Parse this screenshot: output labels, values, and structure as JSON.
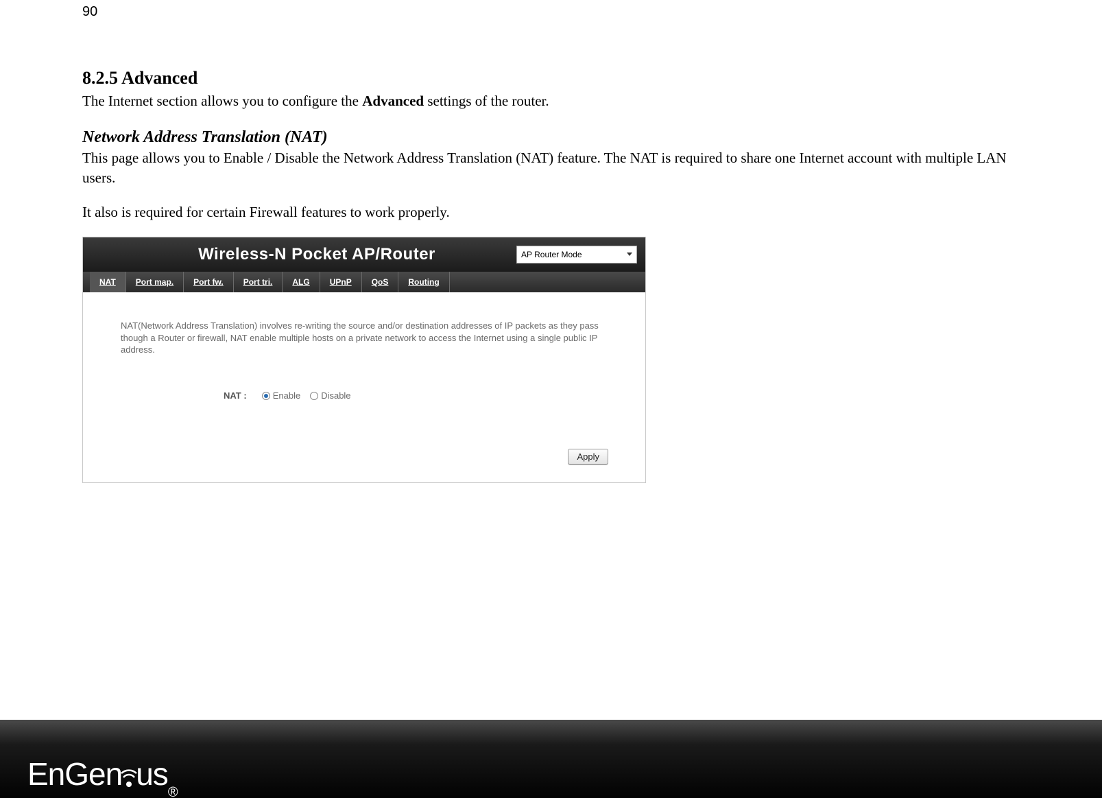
{
  "page_number": "90",
  "section": {
    "heading": "8.2.5 Advanced",
    "intro_pre": "The Internet section allows you to configure the ",
    "intro_bold": "Advanced",
    "intro_post": " settings of the router.",
    "sub_heading": "Network Address Translation (NAT)",
    "nat_para": "This page allows you to Enable / Disable the Network Address Translation (NAT) feature. The NAT is required to share one Internet account with multiple LAN users.",
    "firewall_para": "It also is required for certain Firewall features to work properly."
  },
  "router": {
    "title": "Wireless-N Pocket AP/Router",
    "mode_selected": "AP Router Mode",
    "tabs": {
      "nat": "NAT",
      "port_map": "Port map.",
      "port_fw": "Port fw.",
      "port_tri": "Port tri.",
      "alg": "ALG",
      "upnp": "UPnP",
      "qos": "QoS",
      "routing": "Routing"
    },
    "description": "NAT(Network Address Translation) involves re-writing the source and/or destination addresses of IP packets as they pass though a Router or firewall, NAT enable multiple hosts on a private network to access the Internet using a single public IP address.",
    "nat_label": "NAT :",
    "option_enable": "Enable",
    "option_disable": "Disable",
    "nat_selected": "enable",
    "apply_label": "Apply"
  },
  "footer": {
    "logo_text": "EnGenius",
    "registered": "®"
  }
}
